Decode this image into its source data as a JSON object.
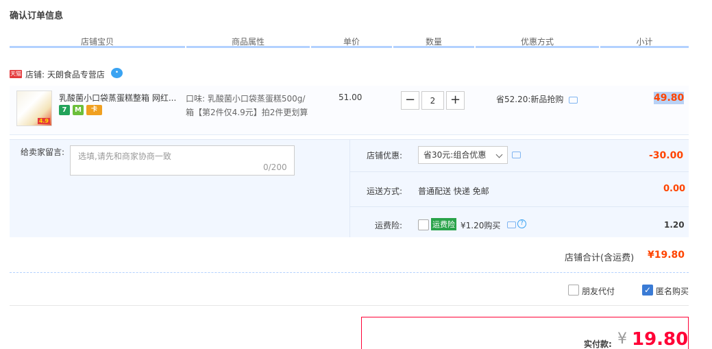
{
  "page": {
    "title": "确认订单信息"
  },
  "columns": [
    "店铺宝贝",
    "商品属性",
    "单价",
    "数量",
    "优惠方式",
    "小计"
  ],
  "shop": {
    "badge": "天猫",
    "name": "店铺: 天朗食品专营店"
  },
  "item": {
    "name": "乳酸菌小口袋蒸蛋糕整箱 网红...",
    "thumb_badge": "4.9",
    "tags": [
      "7",
      "M",
      "卡"
    ],
    "attr_line1": "口味: 乳酸菌小口袋蒸蛋糕500g/",
    "attr_line2": "箱【第2件仅4.9元】拍2件更划算",
    "price": "51.00",
    "quantity": "2",
    "minus": "−",
    "plus": "+",
    "promo": "省52.20:新品抢购",
    "subtotal": "49.80"
  },
  "message": {
    "label": "给卖家留言:",
    "placeholder": "选填,请先和商家协商一致",
    "counter": "0/200"
  },
  "shop_discount": {
    "label": "店铺优惠:",
    "selected": "省30元:组合优惠",
    "value": "-30.00"
  },
  "shipping": {
    "label": "运送方式:",
    "method": "普通配送 快递 免邮",
    "value": "0.00"
  },
  "insurance": {
    "label": "运费险:",
    "badge": "运费险",
    "text": "¥1.20购买",
    "value": "1.20",
    "help": "?"
  },
  "shop_total": {
    "label": "店铺合计(含运费)",
    "value": "¥19.80"
  },
  "options": {
    "friend_pay": "朋友代付",
    "anonymous": "匿名购买",
    "anonymous_checked": true
  },
  "payment": {
    "label": "实付款:",
    "currency": "¥",
    "amount": "19.80"
  },
  "colors": {
    "accent": "#ff4400",
    "header_line": "#b2d1ff",
    "pay_border": "#ff0036",
    "checkbox": "#3a7bd5"
  },
  "icons": {
    "wangwang": "wangwang-chat-icon",
    "message": "message-bubble-icon",
    "help": "question-circle-icon"
  }
}
